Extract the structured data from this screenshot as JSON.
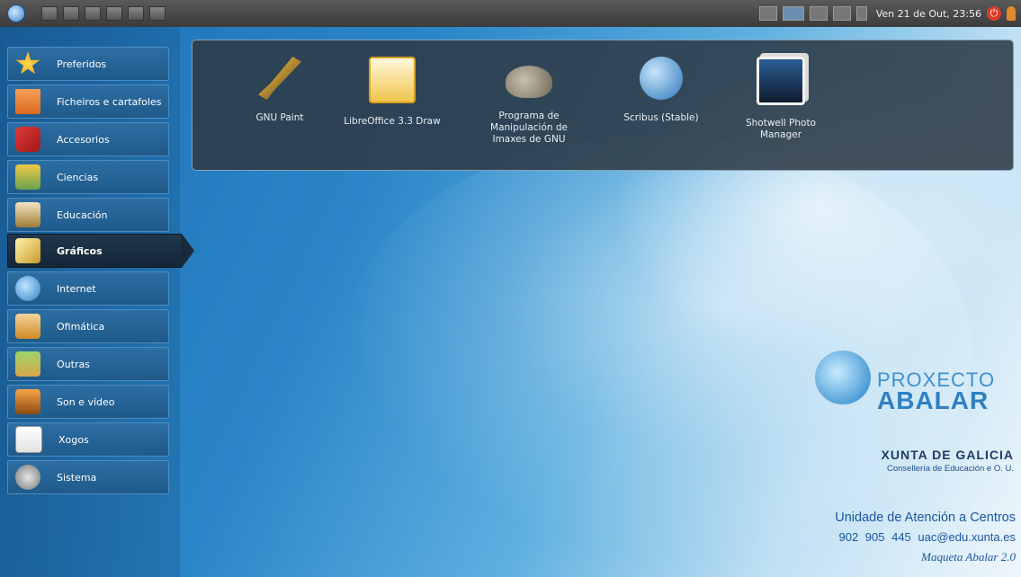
{
  "top_panel": {
    "clock": "Ven 21 de Out, 23:56",
    "icons": [
      "ubuntu-logo-icon",
      "window-icon",
      "network-icon",
      "battery-icon",
      "volume-icon",
      "power-icon",
      "user-icon"
    ]
  },
  "sidebar": {
    "items": [
      {
        "label": "Preferidos",
        "icon": "star-icon"
      },
      {
        "label": "Ficheiros e cartafoles",
        "icon": "folder-icon"
      },
      {
        "label": "Accesorios",
        "icon": "knife-icon"
      },
      {
        "label": "Ciencias",
        "icon": "flask-icon"
      },
      {
        "label": "Educación",
        "icon": "education-icon"
      },
      {
        "label": "Gráficos",
        "icon": "brush-icon",
        "active": true
      },
      {
        "label": "Internet",
        "icon": "globe-icon"
      },
      {
        "label": "Ofimática",
        "icon": "office-icon"
      },
      {
        "label": "Outras",
        "icon": "other-icon"
      },
      {
        "label": "Son e vídeo",
        "icon": "media-icon"
      },
      {
        "label": "Xogos",
        "icon": "cards-icon"
      },
      {
        "label": "Sistema",
        "icon": "system-icon"
      }
    ]
  },
  "apps": [
    {
      "label": "GNU Paint",
      "icon": "paintbrush-icon"
    },
    {
      "label": "LibreOffice 3.3 Draw",
      "icon": "libreoffice-draw-icon"
    },
    {
      "label": "Programa de Manipulación de Imaxes de GNU",
      "icon": "gimp-icon"
    },
    {
      "label": "Scribus (Stable)",
      "icon": "scribus-icon"
    },
    {
      "label": "Shotwell Photo Manager",
      "icon": "shotwell-icon"
    }
  ],
  "branding": {
    "proxecto": "PROXECTO",
    "abalar": "ABALAR",
    "xunta": "XUNTA DE GALICIA",
    "conselleria": "Consellería de Educación e O. U.",
    "uac_title": "Unidade de Atención a Centros",
    "uac_contact": "902 905 445   uac@edu.xunta.es",
    "maqueta": "Maqueta Abalar 2.0"
  },
  "colors": {
    "panel": "#3c3c3c",
    "sidebar_item": "#1f5a8b",
    "active_item": "#172a3b",
    "apps_panel": "#2d3a46"
  }
}
